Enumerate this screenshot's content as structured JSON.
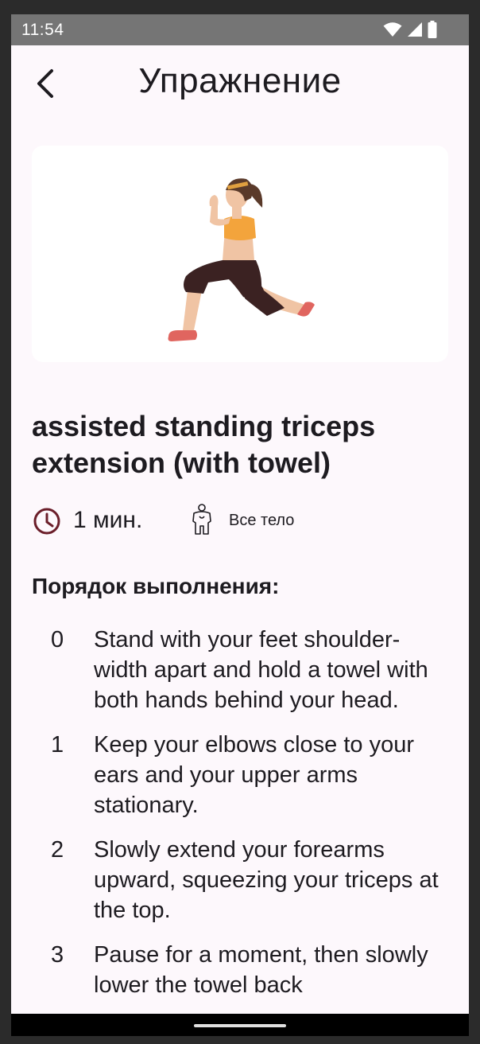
{
  "status_bar": {
    "time": "11:54",
    "icons": [
      "wifi-icon",
      "signal-icon",
      "battery-icon"
    ]
  },
  "app_bar": {
    "back_icon": "chevron-left-icon",
    "title": "Упражнение"
  },
  "exercise": {
    "image": "woman-lunge-illustration",
    "title": "assisted standing triceps extension (with towel)",
    "duration": "1  мин.",
    "body_part": "Все тело",
    "steps_header": "Порядок выполнения:",
    "steps": [
      {
        "num": "0",
        "text": "Stand with your feet shoulder-width apart and hold a towel with both hands behind your head."
      },
      {
        "num": "1",
        "text": "Keep your elbows close to your ears and your upper arms stationary."
      },
      {
        "num": "2",
        "text": "Slowly extend your forearms upward, squeezing your triceps at the top."
      },
      {
        "num": "3",
        "text": "Pause for a moment, then slowly lower the towel back"
      }
    ]
  },
  "colors": {
    "background": "#fdf8fc",
    "text": "#1d1b20",
    "accent": "#6b1e2a",
    "status_bar": "#757575"
  }
}
